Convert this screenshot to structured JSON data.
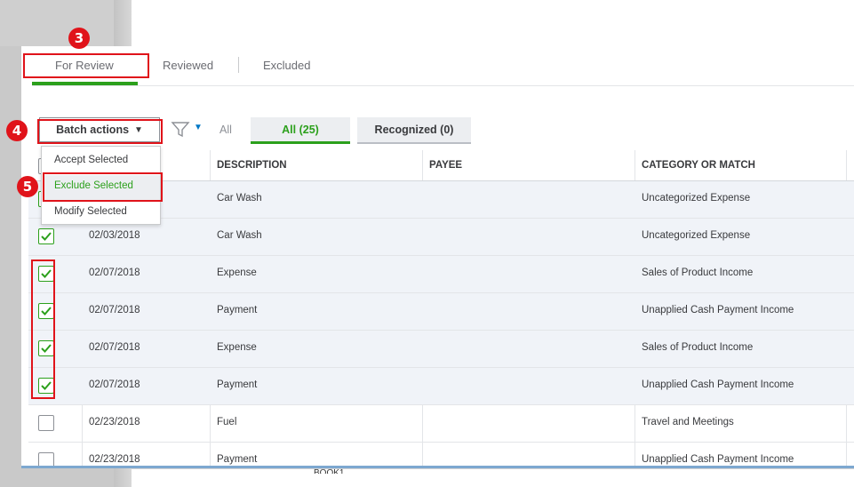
{
  "tabs": [
    {
      "label": "For Review"
    },
    {
      "label": "Reviewed"
    },
    {
      "label": "Excluded"
    }
  ],
  "toolbar": {
    "batch_actions_label": "Batch actions",
    "all_label": "All",
    "pills": [
      {
        "label": "All (25)"
      },
      {
        "label": "Recognized (0)"
      }
    ]
  },
  "batch_menu": {
    "items": [
      {
        "label": "Accept Selected"
      },
      {
        "label": "Exclude Selected"
      },
      {
        "label": "Modify Selected"
      }
    ]
  },
  "table": {
    "columns": [
      {
        "label": "DESCRIPTION"
      },
      {
        "label": "PAYEE"
      },
      {
        "label": "CATEGORY OR MATCH"
      }
    ],
    "rows": [
      {
        "date": "",
        "description": "Car Wash",
        "payee": "",
        "category": "Uncategorized Expense",
        "checked": true
      },
      {
        "date": "02/03/2018",
        "description": "Car Wash",
        "payee": "",
        "category": "Uncategorized Expense",
        "checked": true
      },
      {
        "date": "02/07/2018",
        "description": "Expense",
        "payee": "",
        "category": "Sales of Product Income",
        "checked": true
      },
      {
        "date": "02/07/2018",
        "description": "Payment",
        "payee": "",
        "category": "Unapplied Cash Payment Income",
        "checked": true
      },
      {
        "date": "02/07/2018",
        "description": "Expense",
        "payee": "",
        "category": "Sales of Product Income",
        "checked": true
      },
      {
        "date": "02/07/2018",
        "description": "Payment",
        "payee": "",
        "category": "Unapplied Cash Payment Income",
        "checked": true
      },
      {
        "date": "02/23/2018",
        "description": "Fuel",
        "payee": "",
        "category": "Travel and Meetings",
        "checked": false
      },
      {
        "date": "02/23/2018",
        "description": "Payment",
        "payee": "",
        "category": "Unapplied Cash Payment Income",
        "checked": false
      }
    ]
  },
  "annotations": [
    {
      "number": "3"
    },
    {
      "number": "4"
    },
    {
      "number": "5"
    }
  ],
  "bottom_fragment": "BOOK1",
  "colors": {
    "accent_green": "#2ca01c",
    "annotation_red": "#e0131a",
    "filter_blue": "#0077c5"
  }
}
